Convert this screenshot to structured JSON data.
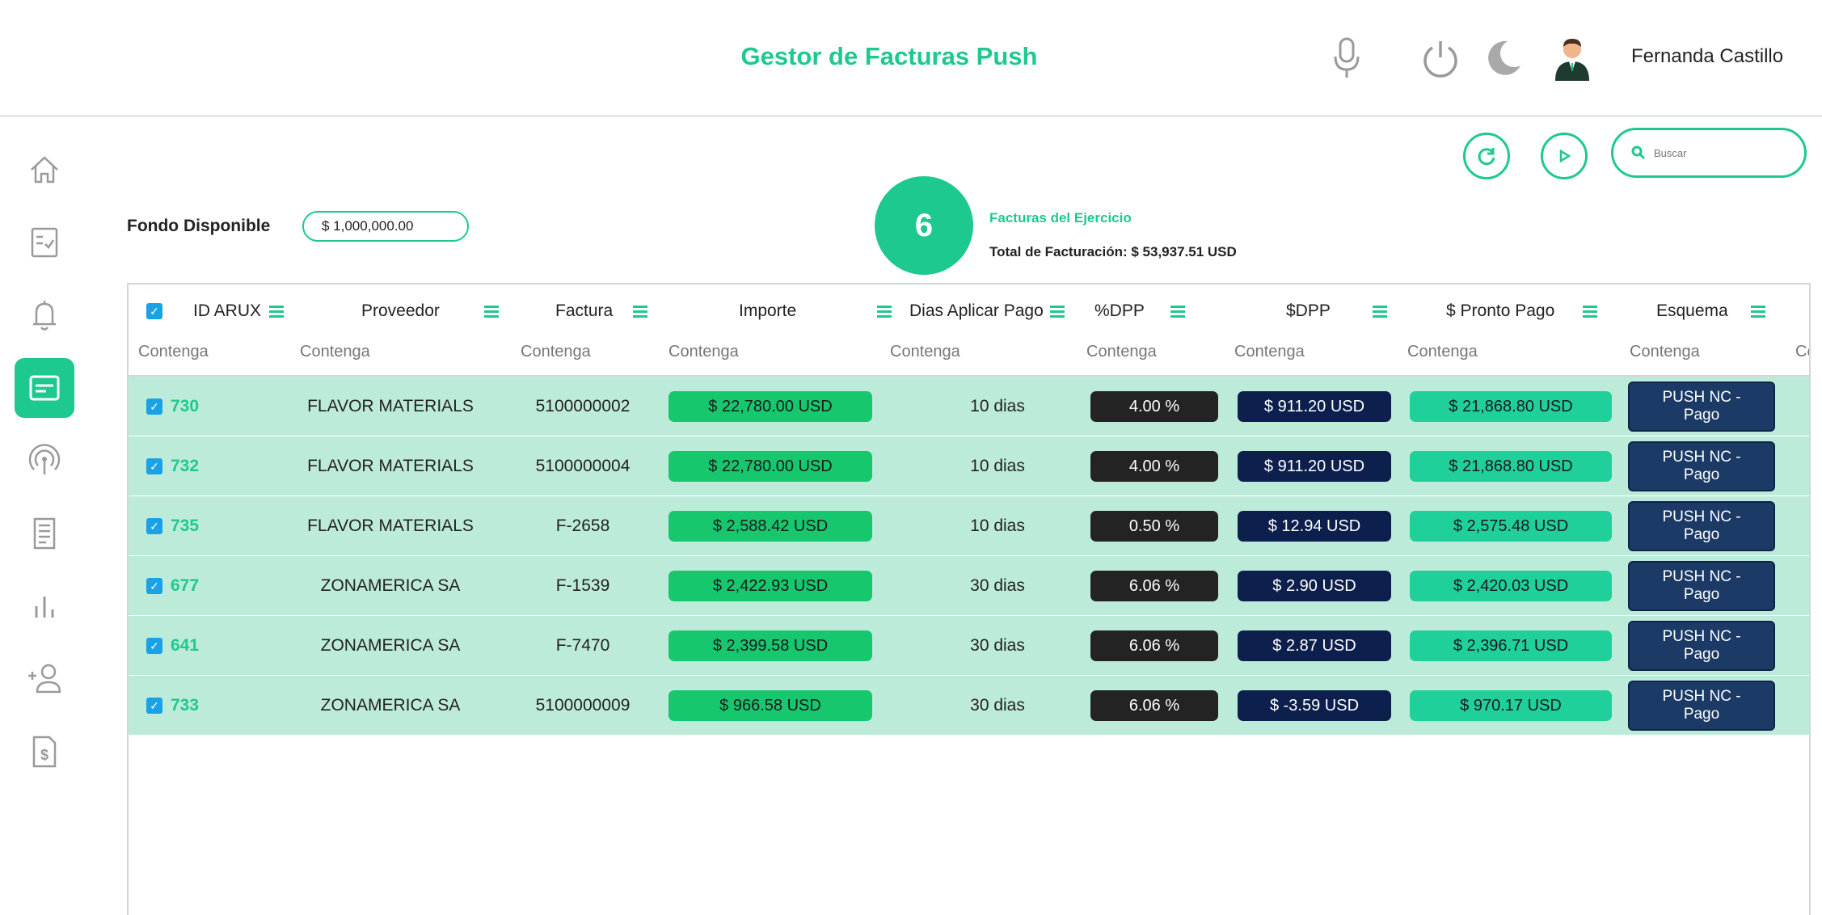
{
  "header": {
    "title": "Gestor de Facturas Push",
    "user_name": "Fernanda Castillo",
    "icons": [
      "microphone-icon",
      "power-icon",
      "moon-icon",
      "avatar"
    ]
  },
  "sidebar": {
    "items": [
      {
        "name": "home-icon"
      },
      {
        "name": "checklist-icon"
      },
      {
        "name": "bell-icon"
      },
      {
        "name": "invoice-card-icon",
        "active": true
      },
      {
        "name": "broadcast-icon"
      },
      {
        "name": "document-icon"
      },
      {
        "name": "bar-chart-icon"
      },
      {
        "name": "add-user-icon"
      },
      {
        "name": "dollar-document-icon"
      }
    ]
  },
  "toolbar": {
    "search_placeholder": "Buscar"
  },
  "summary": {
    "fondo_label": "Fondo Disponible",
    "fondo_value": "$ 1,000,000.00",
    "count": "6",
    "facturas_label": "Facturas del Ejercicio",
    "total_label": "Total de Facturación: $ 53,937.51 USD"
  },
  "table": {
    "headers": [
      "ID ARUX",
      "Proveedor",
      "Factura",
      "Importe",
      "Dias Aplicar Pago",
      "%DPP",
      "$DPP",
      "$ Pronto Pago",
      "Esquema"
    ],
    "filter_placeholder": "Contenga",
    "extra_filter": "Cc",
    "rows": [
      {
        "id": "730",
        "proveedor": "FLAVOR MATERIALS",
        "factura": "5100000002",
        "importe": "$ 22,780.00 USD",
        "dias": "10 dias",
        "pdpp": "4.00 %",
        "sdpp": "$ 911.20 USD",
        "pronto": "$  21,868.80 USD",
        "esquema1": "PUSH NC -",
        "esquema2": "Pago"
      },
      {
        "id": "732",
        "proveedor": "FLAVOR MATERIALS",
        "factura": "5100000004",
        "importe": "$ 22,780.00 USD",
        "dias": "10 dias",
        "pdpp": "4.00 %",
        "sdpp": "$ 911.20 USD",
        "pronto": "$  21,868.80 USD",
        "esquema1": "PUSH NC -",
        "esquema2": "Pago"
      },
      {
        "id": "735",
        "proveedor": "FLAVOR MATERIALS",
        "factura": "F-2658",
        "importe": "$ 2,588.42 USD",
        "dias": "10 dias",
        "pdpp": "0.50 %",
        "sdpp": "$ 12.94 USD",
        "pronto": "$  2,575.48 USD",
        "esquema1": "PUSH NC -",
        "esquema2": "Pago"
      },
      {
        "id": "677",
        "proveedor": "ZONAMERICA SA",
        "factura": "F-1539",
        "importe": "$ 2,422.93 USD",
        "dias": "30 dias",
        "pdpp": "6.06 %",
        "sdpp": "$ 2.90 USD",
        "pronto": "$  2,420.03 USD",
        "esquema1": "PUSH NC -",
        "esquema2": "Pago"
      },
      {
        "id": "641",
        "proveedor": "ZONAMERICA SA",
        "factura": "F-7470",
        "importe": "$ 2,399.58 USD",
        "dias": "30 dias",
        "pdpp": "6.06 %",
        "sdpp": "$ 2.87 USD",
        "pronto": "$  2,396.71 USD",
        "esquema1": "PUSH NC -",
        "esquema2": "Pago"
      },
      {
        "id": "733",
        "proveedor": "ZONAMERICA SA",
        "factura": "5100000009",
        "importe": "$ 966.58 USD",
        "dias": "30 dias",
        "pdpp": "6.06 %",
        "sdpp": "$ -3.59 USD",
        "pronto": "$  970.17 USD",
        "esquema1": "PUSH NC -",
        "esquema2": "Pago"
      }
    ]
  },
  "colors": {
    "accent": "#1ec98f",
    "row_bg": "#bdebd9",
    "importe": "#17c76e",
    "pdpp": "#232323",
    "sdpp": "#0d1f4d",
    "pronto": "#1fd09a",
    "esquema": "#1b3a66"
  }
}
